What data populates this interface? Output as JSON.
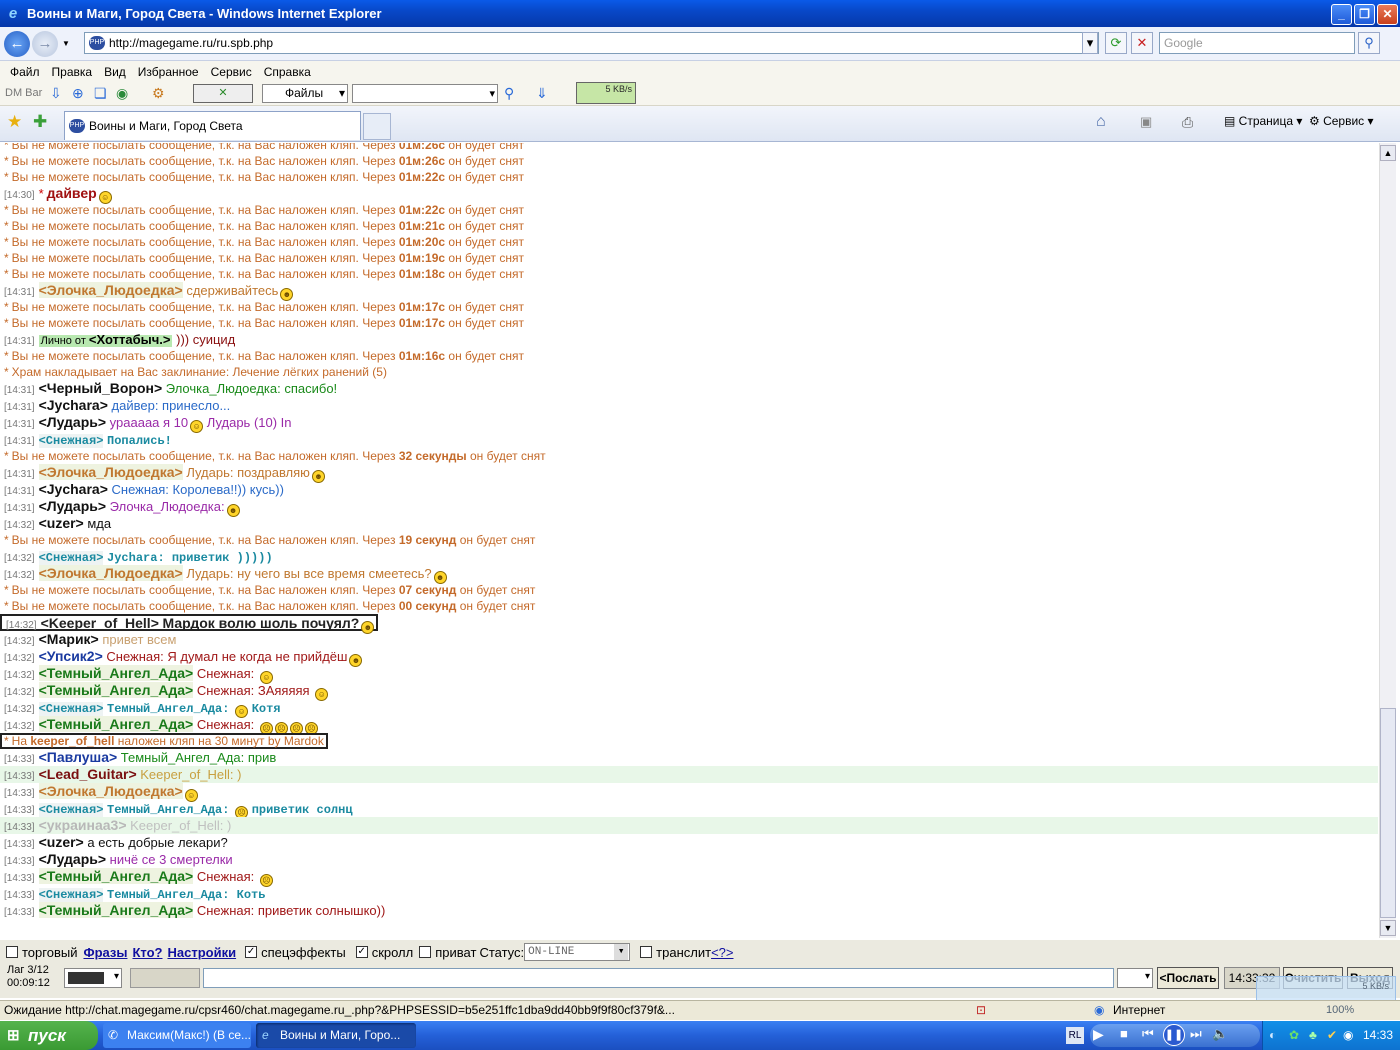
{
  "window": {
    "title": "Воины и Маги, Город Света - Windows Internet Explorer"
  },
  "address": {
    "url": "http://magegame.ru/ru.spb.php",
    "search_placeholder": "Google"
  },
  "menu": [
    "Файл",
    "Правка",
    "Вид",
    "Избранное",
    "Сервис",
    "Справка"
  ],
  "dmbar": {
    "label": "DM Bar",
    "files_label": "Файлы",
    "speed": "5 KB/s"
  },
  "tabs": {
    "active": "Воины и Маги, Город Света",
    "page_label": "Страница",
    "tools_label": "Сервис"
  },
  "sysmsg": {
    "pre": "Вы не можете посылать сообщение, т.к. на Вас наложен кляп. Через",
    "post": "он будет снят"
  },
  "chat": {
    "l1": "01м:26с",
    "l2": "01м:22с",
    "dt": "[14:30]",
    "dn": "дайвер",
    "s3": "01м:22с",
    "s4": "01м:21с",
    "s5": "01м:20с",
    "s6": "01м:19с",
    "s7": "01м:18с",
    "t31": "[14:31]",
    "t32": "[14:32]",
    "t33": "[14:33]",
    "e1n": "<Элочка_Людоедка>",
    "e1t": "сдерживайтесь",
    "s8": "01м:17с",
    "s9": "01м:17с",
    "pm_label": "Лично от",
    "pm_nick": "<Хоттабыч.>",
    "pm_text": "))) суицид",
    "s10": "01м:16с",
    "temple": "Храм накладывает на Вас заклинание: Лечение лёгких ранений (5)",
    "cv_n": "<Черный_Ворон>",
    "cv_t": "Элочка_Людоедка: спасибо!",
    "jy1_n": "<Jychara>",
    "jy1_t": "дайвер: принесло...",
    "lu1_n": "<Лударь>",
    "lu1_t": "урааааа я 10",
    "lu1_t2": "Лударь (10) In",
    "sn1_n": "<Снежная>",
    "sn1_t": "Попались!",
    "s11": "32 секунды",
    "e2t": "Лударь: поздравляю",
    "jy2_t": "Снежная: Королева!!)) кусь))",
    "lu2_t": "Элочка_Людоедка:",
    "uz1_n": "<uzer>",
    "uz1_t": "мда",
    "s12": "19 секунд",
    "sn2_t": "Jychara: приветик )))))",
    "e3t": "Лударь: ну чего вы все время смеетесь?",
    "s13": "07 секунд",
    "s14": "00 секунд",
    "kh_n": "<Keeper_of_Hell>",
    "kh_t": "Мардок волю шоль почуял?",
    "mk_n": "<Марик>",
    "mk_t": "привет всем",
    "up_n": "<Упсик2>",
    "up_t": "Снежная: Я думал не когда не прийдёш",
    "ta_n": "<Темный_Ангел_Ада>",
    "ta1_t": "Снежная:",
    "ta2_t": "Снежная: ЗАяяяяя",
    "sn3_t": "Темный_Ангел_Ада:",
    "sn3_t2": "Котя",
    "gag_pre": "На",
    "gag_nick": "keeper_of_hell",
    "gag_post": "наложен кляп на 30 минут by Mardok",
    "pv_n": "<Павлуша>",
    "pv_t": "Темный_Ангел_Ада: прив",
    "lg_n": "<Lead_Guitar>",
    "lg_t": "Keeper_of_Hell: )",
    "sn4_t2": "приветик солнц",
    "uk_n": "<украинаа3>",
    "uk_t": "Keeper_of_Hell: )",
    "uz2_t": "а есть добрые лекари?",
    "lu3_t": "ничё се 3 смертелки",
    "sn5_t": "Темный_Ангел_Ада: Коть",
    "ta4_t": "Снежная: приветик солнышко))"
  },
  "options": {
    "trade": "торговый",
    "phrases": "Фразы",
    "who": "Кто?",
    "settings": "Настройки",
    "effects": "спецэффекты",
    "scroll": "скролл",
    "private": "приват",
    "status_label": "Статус:",
    "status_value": "ON-LINE",
    "translit": "транслит",
    "help": "<?>"
  },
  "input": {
    "lag": "Лаг 3/12",
    "timer": "00:09:12",
    "send": "<Послать",
    "time": "14:33:32",
    "clear": "Очистить",
    "exit": "Выход"
  },
  "status": {
    "text": "Ожидание http://chat.magegame.ru/cpsr460/chat.magegame.ru_.php?&PHPSESSID=b5e251ffc1dba9dd40bb9f9f80cf379f&...",
    "zone": "Интернет",
    "zoom": "100%",
    "speed": "5 KB/s"
  },
  "taskbar": {
    "start": "пуск",
    "task1": "Максим(Макс!) (В се...",
    "task2": "Воины и Маги, Горо...",
    "lang": "RL",
    "clock": "14:33"
  }
}
